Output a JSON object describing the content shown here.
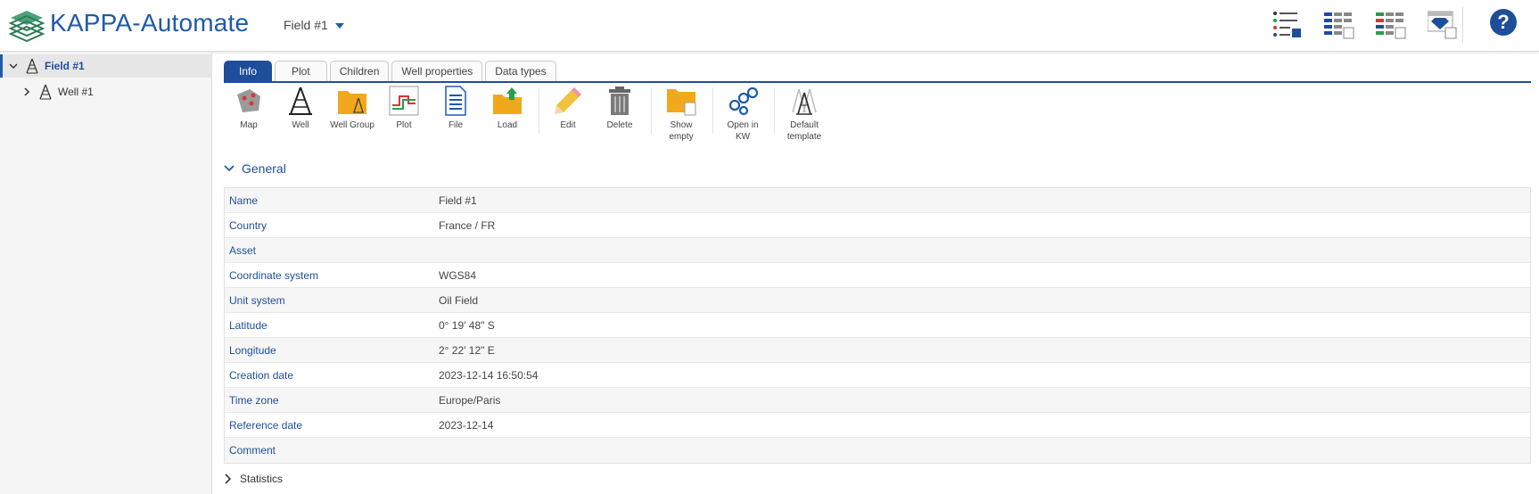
{
  "header": {
    "app_title": "KAPPA-Automate",
    "field_selector": "Field #1",
    "icons": [
      "list-view-icon",
      "grid-view-icon",
      "colored-grid-icon",
      "gem-dashboard-icon"
    ],
    "help_label": "?"
  },
  "sidebar": {
    "items": [
      {
        "label": "Field #1",
        "icon": "rig-icon",
        "expanded": true,
        "selected": true
      },
      {
        "label": "Well #1",
        "icon": "rig-icon",
        "expanded": false,
        "selected": false
      }
    ]
  },
  "tabs": [
    {
      "label": "Info",
      "active": true
    },
    {
      "label": "Plot"
    },
    {
      "label": "Children"
    },
    {
      "label": "Well properties"
    },
    {
      "label": "Data types"
    }
  ],
  "toolbar": [
    {
      "label": "Map",
      "icon": "map-icon"
    },
    {
      "label": "Well",
      "icon": "well-icon"
    },
    {
      "label": "Well Group",
      "icon": "well-group-icon"
    },
    {
      "label": "Plot",
      "icon": "plot-icon"
    },
    {
      "label": "File",
      "icon": "file-icon"
    },
    {
      "label": "Load",
      "icon": "load-icon"
    },
    {
      "label": "Edit",
      "icon": "edit-icon"
    },
    {
      "label": "Delete",
      "icon": "delete-icon"
    },
    {
      "label": "Show\nempty",
      "icon": "show-empty-icon"
    },
    {
      "label": "Open in\nKW",
      "icon": "open-kw-icon"
    },
    {
      "label": "Default\ntemplate",
      "icon": "default-template-icon"
    }
  ],
  "general": {
    "title": "General",
    "rows": [
      {
        "key": "Name",
        "value": "Field #1"
      },
      {
        "key": "Country",
        "value": "France / FR"
      },
      {
        "key": "Asset",
        "value": ""
      },
      {
        "key": "Coordinate system",
        "value": "WGS84"
      },
      {
        "key": "Unit system",
        "value": "Oil Field"
      },
      {
        "key": "Latitude",
        "value": "0° 19' 48\" S"
      },
      {
        "key": "Longitude",
        "value": "2° 22' 12\" E"
      },
      {
        "key": "Creation date",
        "value": "2023-12-14 16:50:54"
      },
      {
        "key": "Time zone",
        "value": "Europe/Paris"
      },
      {
        "key": "Reference date",
        "value": "2023-12-14"
      },
      {
        "key": "Comment",
        "value": ""
      }
    ]
  },
  "statistics": {
    "title": "Statistics"
  },
  "colors": {
    "accent": "#1e4e9a",
    "title": "#1e5aa8",
    "folder": "#f2a81d"
  }
}
